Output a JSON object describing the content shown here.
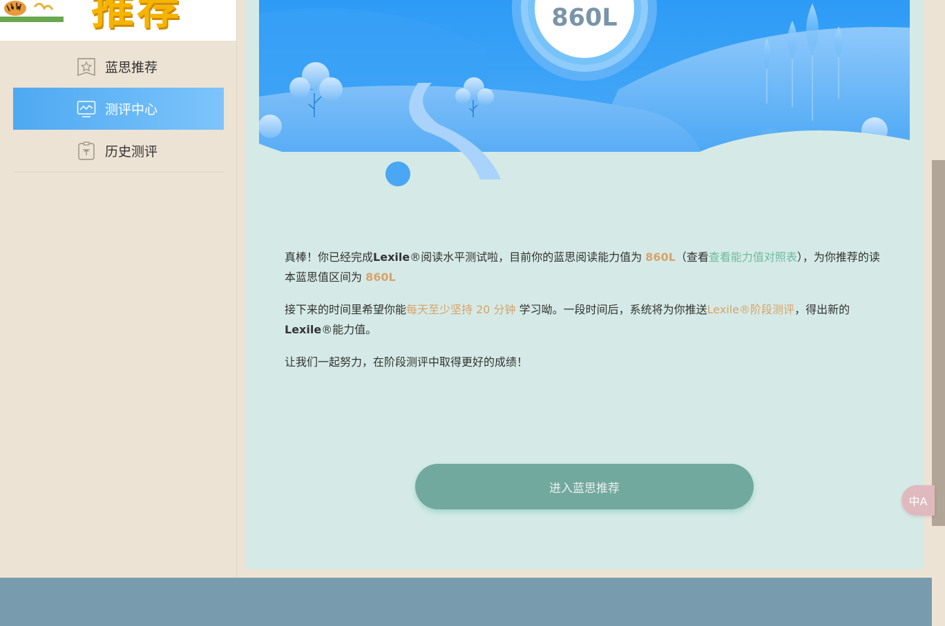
{
  "banner": {
    "text": "推荐"
  },
  "sidebar": {
    "items": [
      {
        "label": "蓝思推荐",
        "icon": "star-bookmark-icon",
        "active": false
      },
      {
        "label": "测评中心",
        "icon": "monitor-chart-icon",
        "active": true
      },
      {
        "label": "历史测评",
        "icon": "clipboard-icon",
        "active": false
      }
    ]
  },
  "hero": {
    "level": "860L"
  },
  "result": {
    "p1_a": "真棒！你已经完成",
    "p1_lexile": "Lexile",
    "p1_reg": "®",
    "p1_b": "阅读水平测试啦，目前你的蓝思阅读能力值为 ",
    "p1_level": "860L",
    "p1_c": "（查看",
    "p1_link": "查看能力值对照表",
    "p1_d": "），为你推荐的读本蓝思值区间为 ",
    "p1_range": "860L",
    "p2_a": "接下来的时间里希望你能",
    "p2_hl": "每天至少坚持 20 分钟",
    "p2_b": " 学习呦。一段时间后，系统将为你推送",
    "p2_link": "Lexile®阶段测评",
    "p2_c": "，得出新的",
    "p2_lexile": "Lexile",
    "p2_reg": "®",
    "p2_d": "能力值。",
    "p3": "让我们一起努力，在阶段测评中取得更好的成绩！"
  },
  "cta": {
    "label": "进入蓝思推荐"
  },
  "translate": {
    "label": "中A"
  },
  "colors": {
    "accent_orange": "#d8a26b",
    "link_green": "#6fba9e",
    "button": "#72a99e",
    "active_nav": "#4ea9f1",
    "footer": "#789cae"
  }
}
